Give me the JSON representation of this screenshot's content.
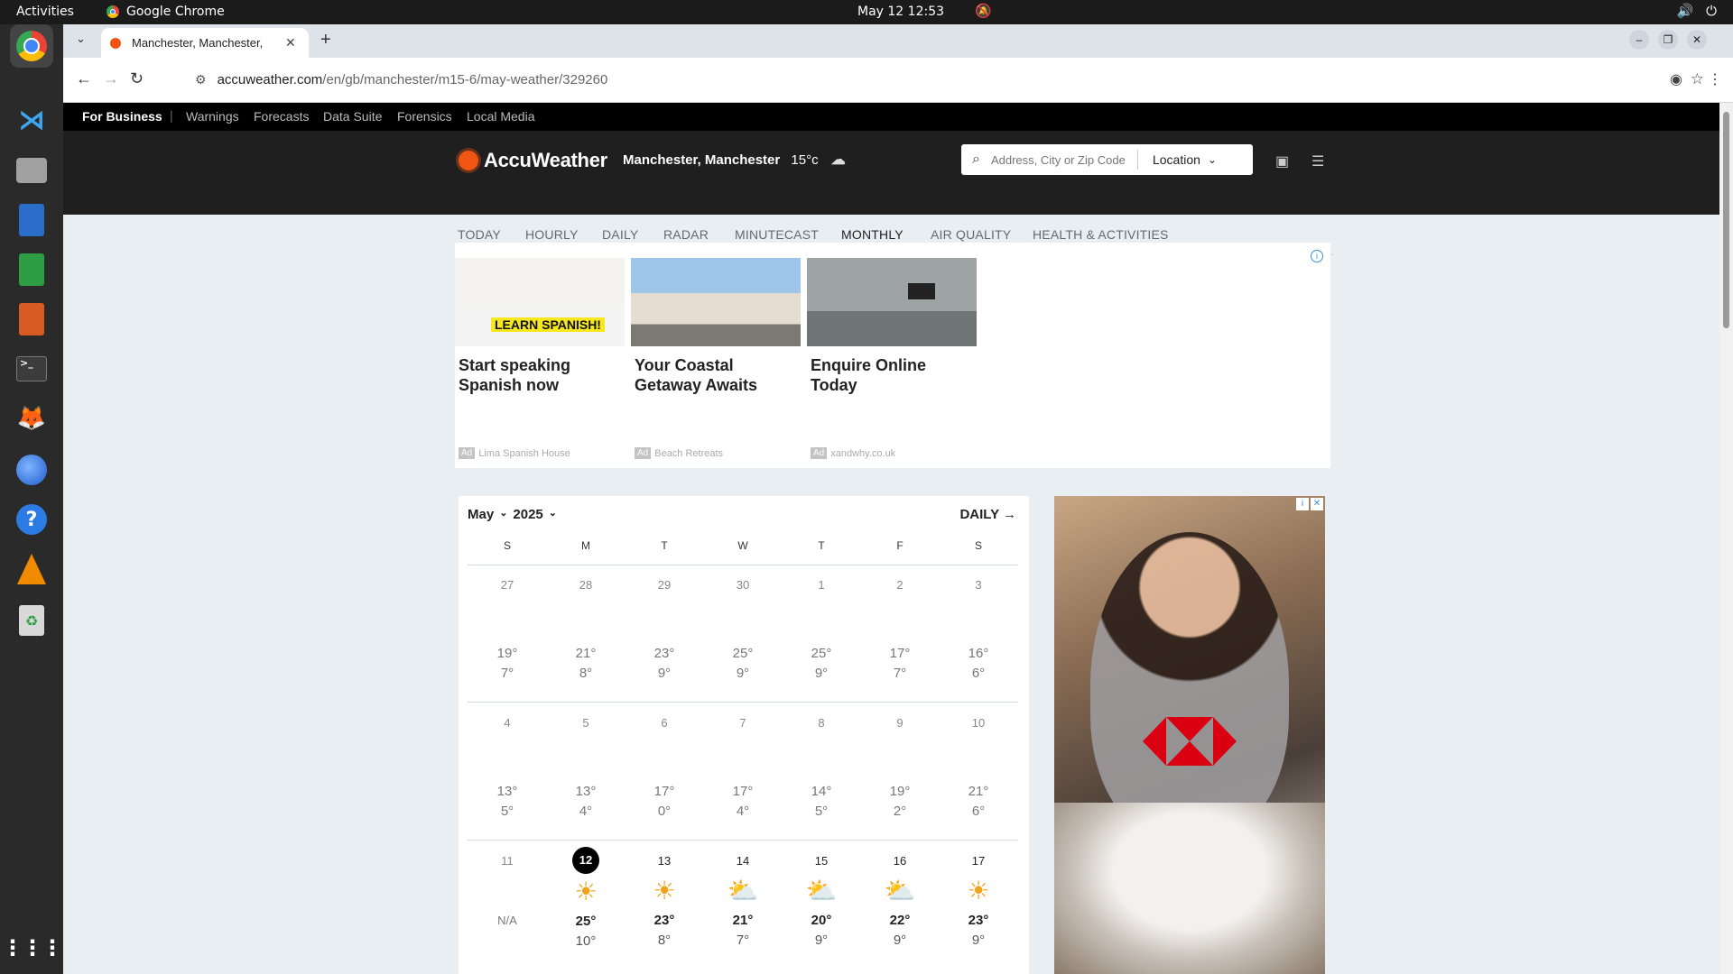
{
  "system": {
    "activities": "Activities",
    "app_name": "Google Chrome",
    "clock": "May 12  12:53"
  },
  "browser": {
    "tab_title": "Manchester, Manchester,",
    "url_host": "accuweather.com",
    "url_path": "/en/gb/manchester/m15-6/may-weather/329260"
  },
  "site": {
    "top_links": {
      "business": "For Business",
      "sep": "|",
      "items": [
        "Warnings",
        "Forecasts",
        "Data Suite",
        "Forensics",
        "Local Media"
      ]
    },
    "logo_text": "AccuWeather",
    "location": "Manchester, Manchester",
    "current_temp": "15°c",
    "search": {
      "placeholder": "Address, City or Zip Code",
      "location_button": "Location"
    },
    "tabs": [
      "TODAY",
      "HOURLY",
      "DAILY",
      "RADAR",
      "MINUTECAST",
      "MONTHLY",
      "AIR QUALITY",
      "HEALTH & ACTIVITIES"
    ],
    "active_tab": "MONTHLY"
  },
  "ads": [
    {
      "headline": "Start speaking Spanish now",
      "image_text": "LEARN SPANISH!",
      "badge": "Ad",
      "source": "Lima Spanish House"
    },
    {
      "headline": "Your Coastal Getaway Awaits",
      "badge": "Ad",
      "source": "Beach Retreats"
    },
    {
      "headline": "Enquire Online Today",
      "badge": "Ad",
      "source": "xandwhy.co.uk"
    }
  ],
  "calendar": {
    "month": "May",
    "year": "2025",
    "daily_link": "DAILY",
    "weekdays": [
      "S",
      "M",
      "T",
      "W",
      "T",
      "F",
      "S"
    ],
    "weeks": [
      [
        {
          "day": "27",
          "hi": "19°",
          "lo": "7°"
        },
        {
          "day": "28",
          "hi": "21°",
          "lo": "8°"
        },
        {
          "day": "29",
          "hi": "23°",
          "lo": "9°"
        },
        {
          "day": "30",
          "hi": "25°",
          "lo": "9°"
        },
        {
          "day": "1",
          "hi": "25°",
          "lo": "9°"
        },
        {
          "day": "2",
          "hi": "17°",
          "lo": "7°"
        },
        {
          "day": "3",
          "hi": "16°",
          "lo": "6°"
        }
      ],
      [
        {
          "day": "4",
          "hi": "13°",
          "lo": "5°"
        },
        {
          "day": "5",
          "hi": "13°",
          "lo": "4°"
        },
        {
          "day": "6",
          "hi": "17°",
          "lo": "0°"
        },
        {
          "day": "7",
          "hi": "17°",
          "lo": "4°"
        },
        {
          "day": "8",
          "hi": "14°",
          "lo": "5°"
        },
        {
          "day": "9",
          "hi": "19°",
          "lo": "2°"
        },
        {
          "day": "10",
          "hi": "21°",
          "lo": "6°"
        }
      ],
      [
        {
          "day": "11",
          "hi": "",
          "lo": "N/A",
          "icon": ""
        },
        {
          "day": "12",
          "hi": "25°",
          "lo": "10°",
          "icon": "partly-sunny-icon",
          "today": true
        },
        {
          "day": "13",
          "hi": "23°",
          "lo": "8°",
          "icon": "sunny-icon"
        },
        {
          "day": "14",
          "hi": "21°",
          "lo": "7°",
          "icon": "partly-sunny-icon"
        },
        {
          "day": "15",
          "hi": "20°",
          "lo": "9°",
          "icon": "partly-sunny-icon"
        },
        {
          "day": "16",
          "hi": "22°",
          "lo": "9°",
          "icon": "partly-cloudy-icon"
        },
        {
          "day": "17",
          "hi": "23°",
          "lo": "9°",
          "icon": "sunny-icon"
        }
      ]
    ]
  },
  "colors": {
    "brand_orange": "#f05514",
    "header_bg": "#1f1f1f",
    "page_bg": "#e9eef3",
    "sun_yellow": "#f2a21a"
  }
}
